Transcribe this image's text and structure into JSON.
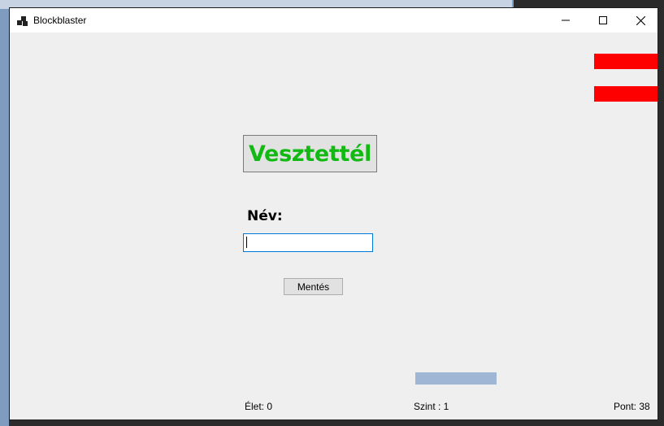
{
  "window": {
    "title": "Blockblaster"
  },
  "game": {
    "result_text": "Vesztettél",
    "name_label": "Név:",
    "name_input": {
      "value": "",
      "placeholder": ""
    },
    "save_label": "Mentés",
    "colors": {
      "result": "#13b913",
      "block": "#ff0000",
      "paddle": "#9fb6d5"
    },
    "blocks_remaining": 2
  },
  "status": {
    "lives": "Élet: 0",
    "level": "Szint : 1",
    "points": "Pont: 38"
  }
}
